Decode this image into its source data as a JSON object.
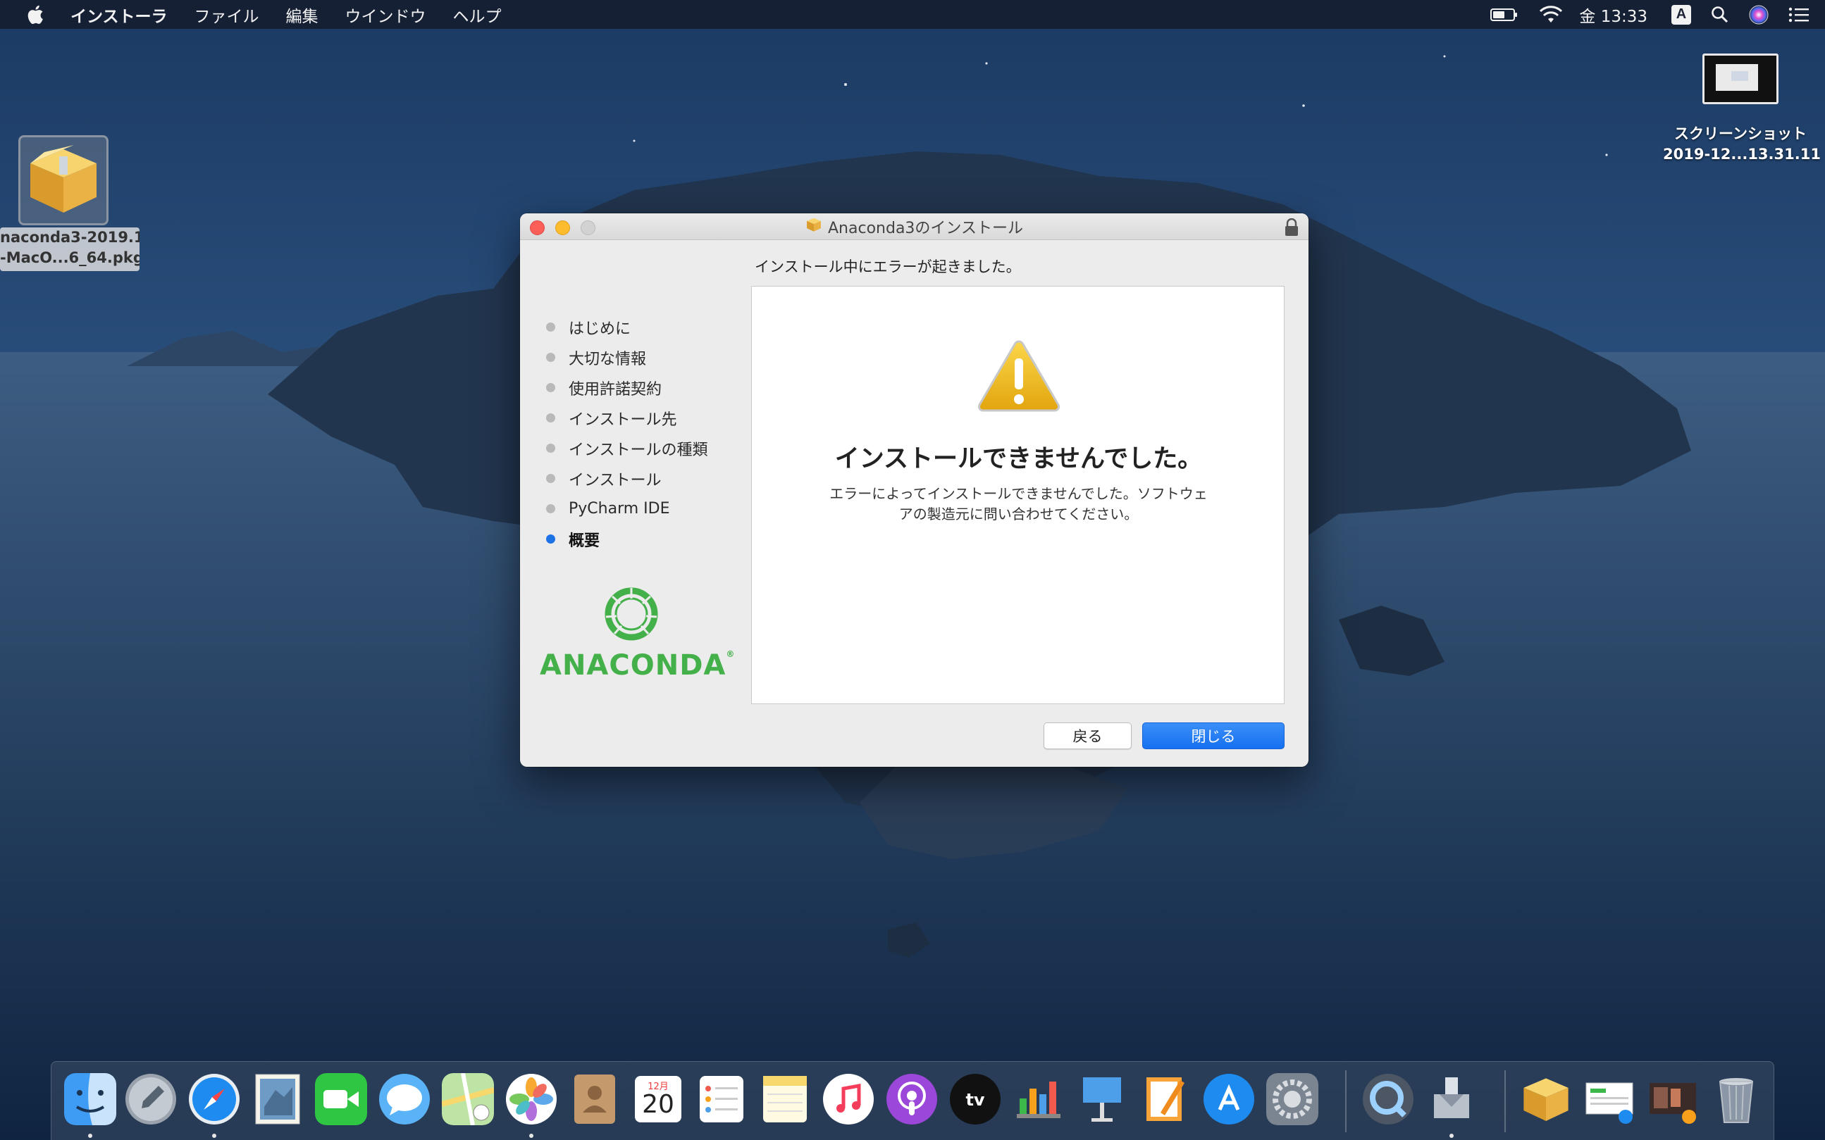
{
  "menubar": {
    "app_name": "インストーラ",
    "menus": [
      "ファイル",
      "編集",
      "ウインドウ",
      "ヘルプ"
    ],
    "clock": "金 13:33",
    "input_method": "A"
  },
  "desktop": {
    "pkg_icon": {
      "line1": "naconda3-2019.1",
      "line2": "-MacO...6_64.pkg"
    },
    "screenshot_icon": {
      "line1": "スクリーンショット",
      "line2": "2019-12...13.31.11"
    }
  },
  "window": {
    "title": "Anaconda3のインストール",
    "heading": "インストール中にエラーが起きました。",
    "steps": [
      "はじめに",
      "大切な情報",
      "使用許諾契約",
      "インストール先",
      "インストールの種類",
      "インストール",
      "PyCharm IDE",
      "概要"
    ],
    "active_step": 7,
    "logo_text": "ANACONDA",
    "logo_mark": "®",
    "fail_title": "インストールできませんでした。",
    "fail_message_line1": "エラーによってインストールできませんでした。ソフトウェ",
    "fail_message_line2": "アの製造元に問い合わせてください。",
    "back_label": "戻る",
    "close_label": "閉じる"
  },
  "dock": {
    "calendar_month": "12月",
    "calendar_day": "20",
    "tv_label": "tv"
  },
  "colors": {
    "accent": "#1d72e6",
    "anaconda_green": "#43b049",
    "warning_yellow": "#f5c324"
  }
}
